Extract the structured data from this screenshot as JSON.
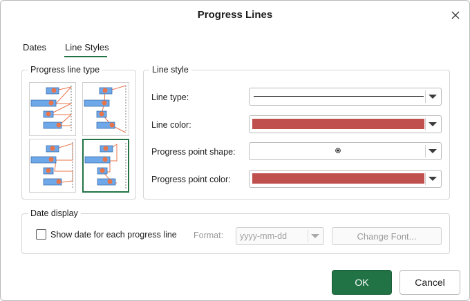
{
  "dialog": {
    "title": "Progress Lines",
    "close_icon": "close-icon"
  },
  "tabs": [
    {
      "label": "Dates",
      "active": false
    },
    {
      "label": "Line Styles",
      "active": true
    }
  ],
  "progress_line_type": {
    "legend": "Progress line type",
    "options": [
      {
        "name": "type-1",
        "selected": false
      },
      {
        "name": "type-2",
        "selected": false
      },
      {
        "name": "type-3",
        "selected": false
      },
      {
        "name": "type-4",
        "selected": true
      }
    ]
  },
  "line_style": {
    "legend": "Line style",
    "line_type_label": "Line type:",
    "line_color_label": "Line color:",
    "point_shape_label": "Progress point shape:",
    "point_color_label": "Progress point color:",
    "line_type_value": "solid-line",
    "line_color": "#c0504d",
    "point_shape": "circle-dot",
    "point_color": "#c0504d"
  },
  "date_display": {
    "legend": "Date display",
    "show_date_label": "Show date for each progress line",
    "show_date_checked": false,
    "format_label": "Format:",
    "format_value": "yyyy-mm-dd",
    "change_font_label": "Change Font..."
  },
  "buttons": {
    "ok": "OK",
    "cancel": "Cancel"
  },
  "colors": {
    "accent": "#217346",
    "bar_fill": "#6fa8e8",
    "line_orange": "#e8744a"
  }
}
